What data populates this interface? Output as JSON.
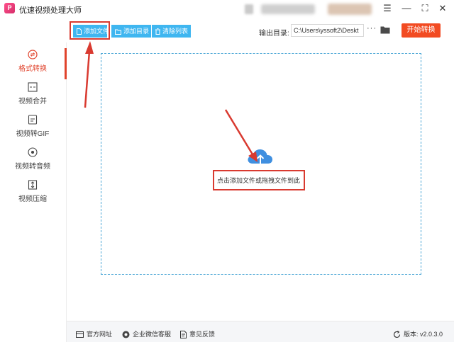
{
  "app": {
    "title": "优速视频处理大师",
    "logo_text": "P"
  },
  "window_controls": {
    "menu": "☰",
    "minimize": "—",
    "maximize": "⛶",
    "close": "✕"
  },
  "sidebar": {
    "items": [
      {
        "label": "格式转换",
        "icon": "format-convert-icon",
        "active": true
      },
      {
        "label": "视频合并",
        "icon": "merge-icon",
        "active": false
      },
      {
        "label": "视频转GIF",
        "icon": "gif-icon",
        "active": false
      },
      {
        "label": "视频转音频",
        "icon": "audio-icon",
        "active": false
      },
      {
        "label": "视频压缩",
        "icon": "compress-icon",
        "active": false
      }
    ]
  },
  "toolbar": {
    "add_file": "添加文件",
    "add_folder": "添加目录",
    "clear_list": "清除列表",
    "output_label": "输出目录:",
    "output_path": "C:\\Users\\yssoft2\\Deskt",
    "more": "···",
    "start": "开始转换"
  },
  "drop_area": {
    "hint": "点击添加文件或拖拽文件到此"
  },
  "footer": {
    "website": "官方网址",
    "wechat": "企业微信客服",
    "feedback": "意见反馈",
    "version_label": "版本:",
    "version": "v2.0.3.0"
  },
  "colors": {
    "accent_blue": "#3fb6f0",
    "accent_red": "#e0432c",
    "start_orange": "#f24b22",
    "annotation_red": "#d93a30"
  }
}
